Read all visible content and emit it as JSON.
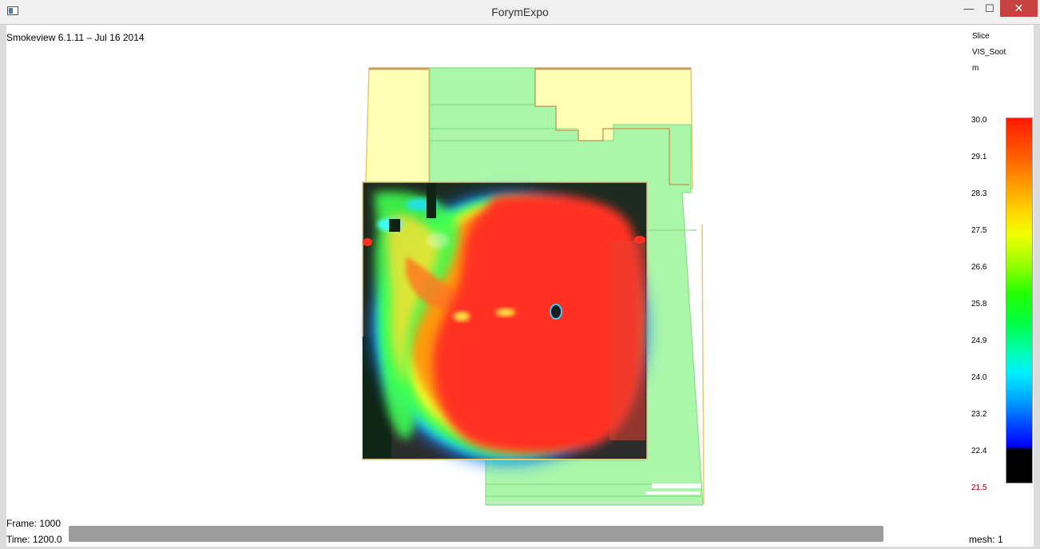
{
  "window": {
    "title": "ForymExpo",
    "minimize_glyph": "—",
    "maximize_glyph": "☐",
    "close_glyph": "✕"
  },
  "viewer": {
    "version": "Smokeview 6.1.11  –  Jul 16 2014",
    "frame": "Frame: 1000",
    "time": "Time: 1200.0",
    "mesh": "mesh: 1"
  },
  "colorbar": {
    "title": "Slice",
    "quantity": "VIS_Soot",
    "unit": "m",
    "ticks": [
      "30.0",
      "29.1",
      "28.3",
      "27.5",
      "26.6",
      "25.8",
      "24.9",
      "24.0",
      "23.2",
      "22.4",
      "21.5"
    ]
  },
  "colors": {
    "building_fill": "#aaf7aa",
    "exterior_fill": "#ffffb4",
    "hot": "#ff3020",
    "dark_floor": "#1d2a20"
  },
  "icons": {
    "app": "smokeview-app-icon",
    "minimize": "minimize-icon",
    "maximize": "maximize-icon",
    "close": "close-icon"
  }
}
